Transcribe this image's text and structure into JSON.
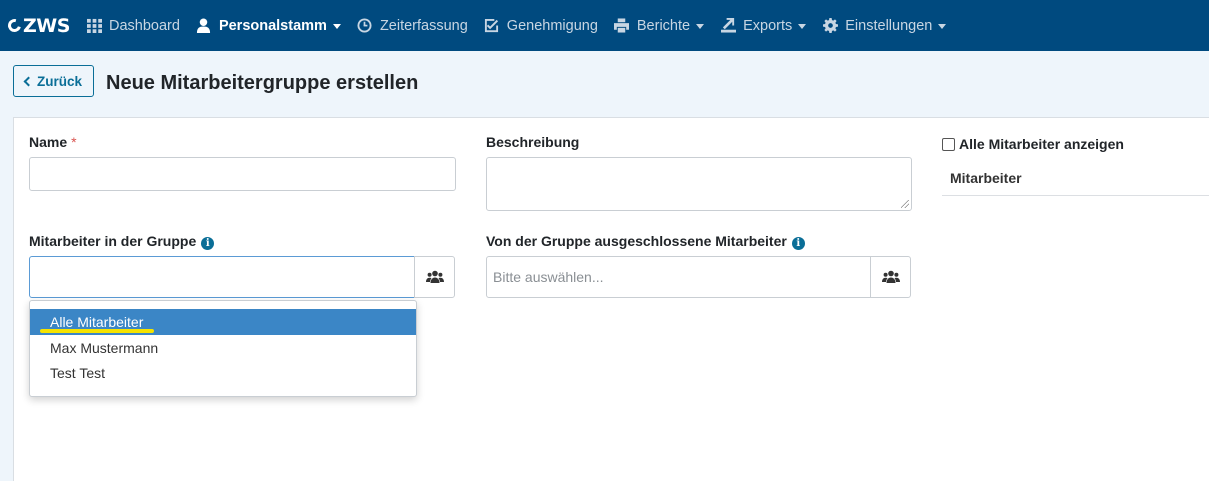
{
  "nav": {
    "brand": "ZWS",
    "items": [
      {
        "label": "Dashboard",
        "icon": "grid-icon",
        "active": false,
        "dropdown": false
      },
      {
        "label": "Personalstamm",
        "icon": "user-icon",
        "active": true,
        "dropdown": true
      },
      {
        "label": "Zeiterfassung",
        "icon": "clock-icon",
        "active": false,
        "dropdown": false
      },
      {
        "label": "Genehmigung",
        "icon": "check-square-icon",
        "active": false,
        "dropdown": false
      },
      {
        "label": "Berichte",
        "icon": "printer-icon",
        "active": false,
        "dropdown": true
      },
      {
        "label": "Exports",
        "icon": "export-icon",
        "active": false,
        "dropdown": true
      },
      {
        "label": "Einstellungen",
        "icon": "gear-icon",
        "active": false,
        "dropdown": true
      }
    ]
  },
  "header": {
    "back_label": "Zurück",
    "title": "Neue Mitarbeitergruppe erstellen"
  },
  "form": {
    "name_label": "Name",
    "required_mark": "*",
    "name_value": "",
    "description_label": "Beschreibung",
    "description_value": "",
    "members_label": "Mitarbeiter in der Gruppe",
    "excluded_label": "Von der Gruppe ausgeschlossene Mitarbeiter",
    "excluded_placeholder": "Bitte auswählen...",
    "info_glyph": "i"
  },
  "side": {
    "show_all_label": "Alle Mitarbeiter anzeigen",
    "column_header": "Mitarbeiter"
  },
  "dropdown": {
    "options": [
      "Alle Mitarbeiter",
      "Max Mustermann",
      "Test Test"
    ],
    "selected_index": 0
  },
  "colors": {
    "navbar": "#004a7f",
    "accent": "#0a6e97",
    "selected": "#3b86c6",
    "highlight": "#f5e300"
  }
}
